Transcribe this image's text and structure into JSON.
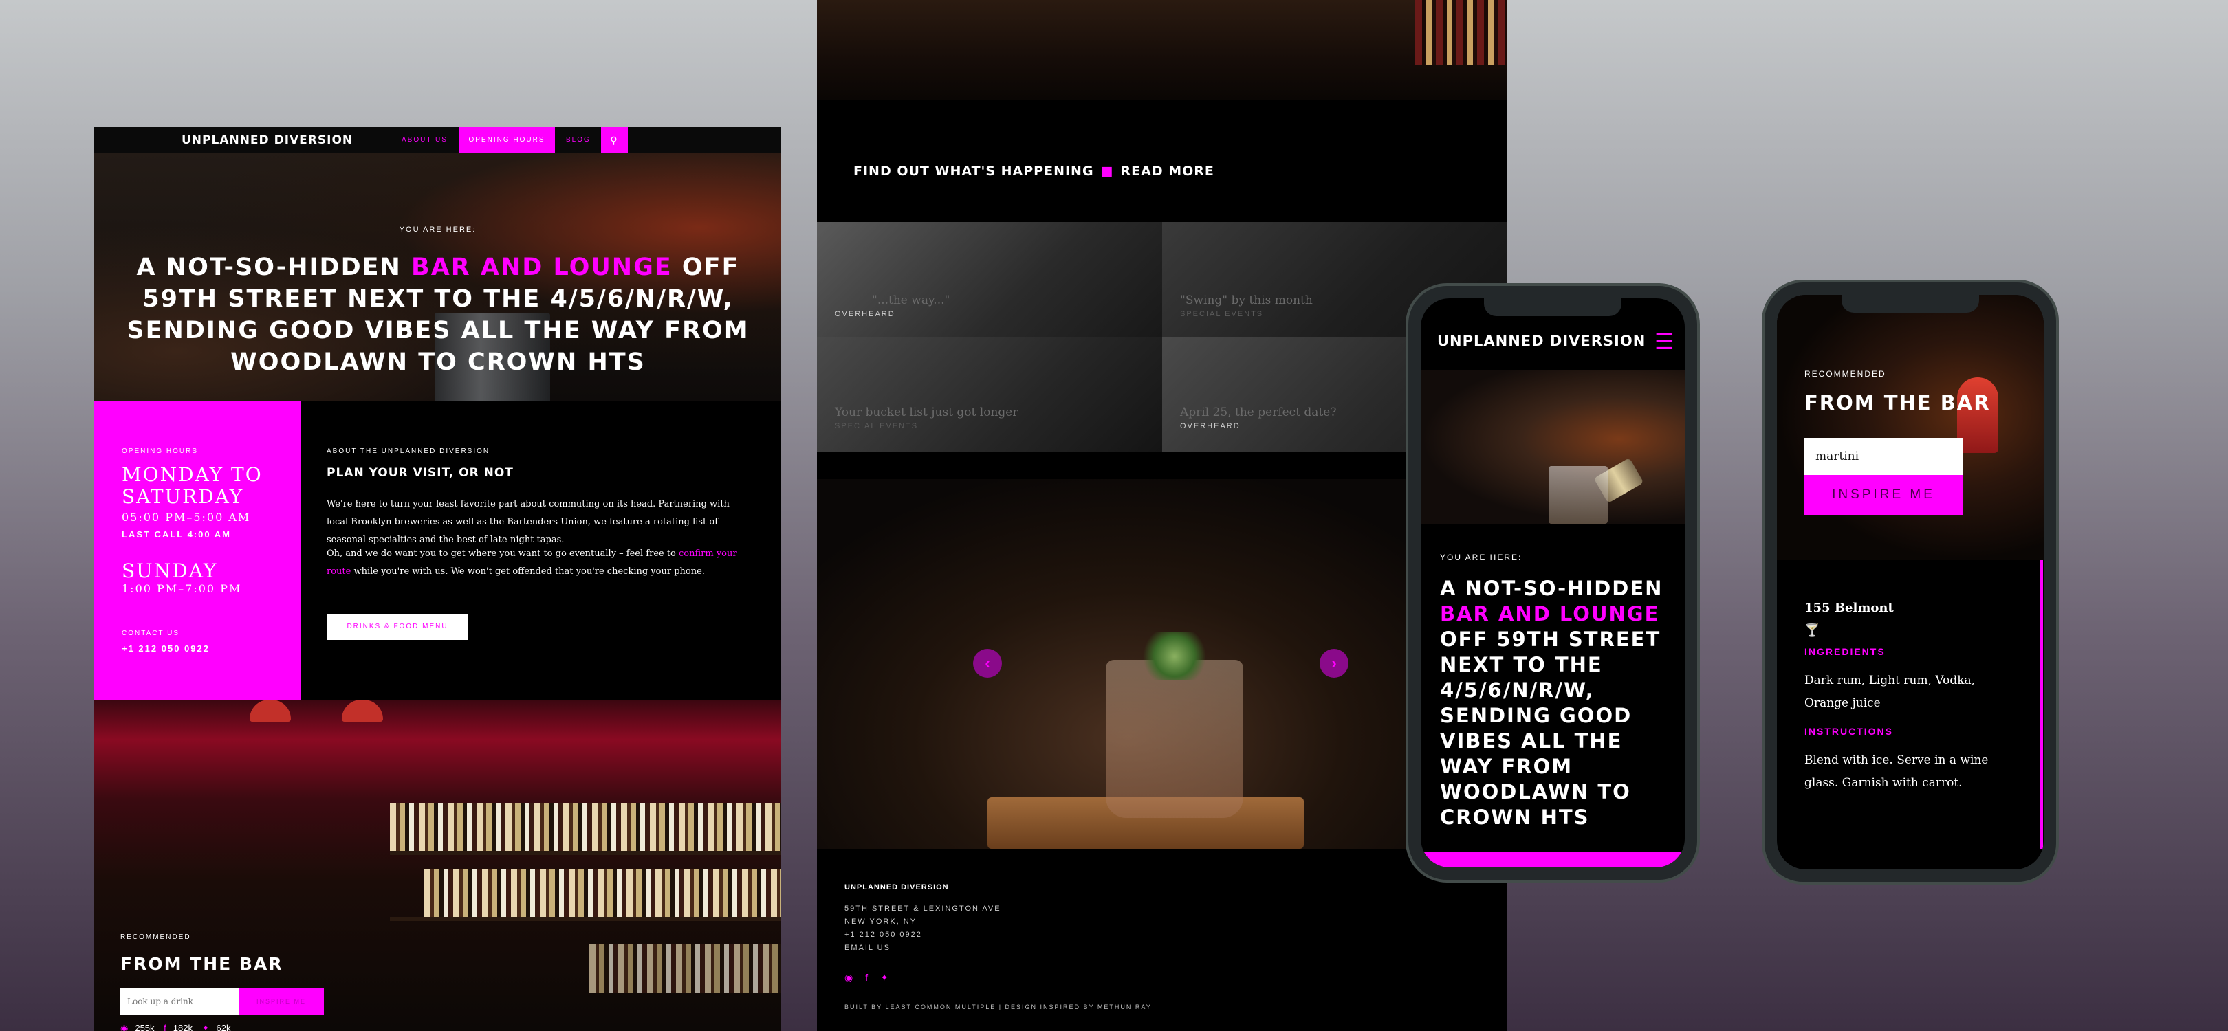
{
  "desktop": {
    "brand": "UNPLANNED DIVERSION",
    "nav": {
      "about": "ABOUT US",
      "hours": "OPENING HOURS",
      "blog": "BLOG",
      "search_icon": "search-icon"
    },
    "hero": {
      "you_are_here": "YOU ARE HERE:",
      "headline_a": "A NOT-SO-HIDDEN ",
      "headline_b": "BAR AND LOUNGE",
      "headline_c": " OFF 59TH STREET NEXT TO THE 4/5/6/N/R/W, SENDING GOOD VIBES ALL THE WAY FROM WOODLAWN TO CROWN HTS"
    },
    "hours": {
      "label": "OPENING HOURS",
      "day1": "MONDAY TO SATURDAY",
      "time1": "05:00 PM–5:00 AM",
      "last_call": "LAST CALL 4:00 AM",
      "day2": "SUNDAY",
      "time2": "1:00 PM–7:00 PM",
      "contact_label": "CONTACT US",
      "phone": "+1 212 050 0922"
    },
    "about": {
      "label": "ABOUT THE UNPLANNED DIVERSION",
      "heading": "PLAN YOUR VISIT, OR NOT",
      "p1": "We're here to turn your least favorite part about commuting on its head. Partnering with local Brooklyn breweries as well as the Bartenders Union, we feature a rotating list of seasonal specialties and the best of late-night tapas.",
      "p2a": "Oh, and we do want you to get where you want to go eventually – feel free to ",
      "p2_link": "confirm your route",
      "p2b": " while you're with us. We won't get offended that you're checking your phone.",
      "button": "DRINKS & FOOD MENU"
    },
    "recommended": {
      "label": "RECOMMENDED",
      "heading": "FROM THE BAR",
      "placeholder": "Look up a drink",
      "button": "INSPIRE ME",
      "instagram": "255k",
      "facebook": "182k",
      "twitter": "62k"
    }
  },
  "middle": {
    "happening": "FIND OUT WHAT'S HAPPENING",
    "read_more": "READ MORE",
    "tiles": [
      {
        "title": "\"...the way...\"",
        "category": "OVERHEARD"
      },
      {
        "title": "\"Swing\" by this month",
        "category": "SPECIAL EVENTS"
      },
      {
        "title": "Your bucket list just got longer",
        "category": "SPECIAL EVENTS"
      },
      {
        "title": "April 25, the perfect date?",
        "category": "OVERHEARD"
      }
    ],
    "arrow_prev": "‹",
    "arrow_next": "›",
    "footer": {
      "brand": "UNPLANNED DIVERSION",
      "address1": "59TH STREET & LEXINGTON AVE",
      "address2": "NEW YORK, NY",
      "phone": "+1 212 050 0922",
      "email": "EMAIL US",
      "credit": "BUILT BY LEAST COMMON MULTIPLE | DESIGN INSPIRED BY METHUN RAY"
    }
  },
  "phone1": {
    "brand": "UNPLANNED DIVERSION",
    "you_are_here": "YOU ARE HERE:",
    "headline_a": "A NOT-SO-HIDDEN ",
    "headline_b": "BAR AND LOUNGE",
    "headline_c": " OFF 59TH STREET NEXT TO THE 4/5/6/N/R/W, SENDING GOOD VIBES ALL THE WAY FROM WOODLAWN TO CROWN HTS"
  },
  "phone2": {
    "recommended": "RECOMMENDED",
    "heading": "FROM THE BAR",
    "input_value": "martini",
    "button": "INSPIRE ME",
    "location": "155 Belmont",
    "ingredients_label": "INGREDIENTS",
    "ingredients": "Dark rum, Light rum, Vodka, Orange juice",
    "instructions_label": "INSTRUCTIONS",
    "instructions": "Blend with ice. Serve in a wine glass. Garnish with carrot."
  },
  "colors": {
    "accent": "#ff00ff",
    "background": "#000000"
  }
}
